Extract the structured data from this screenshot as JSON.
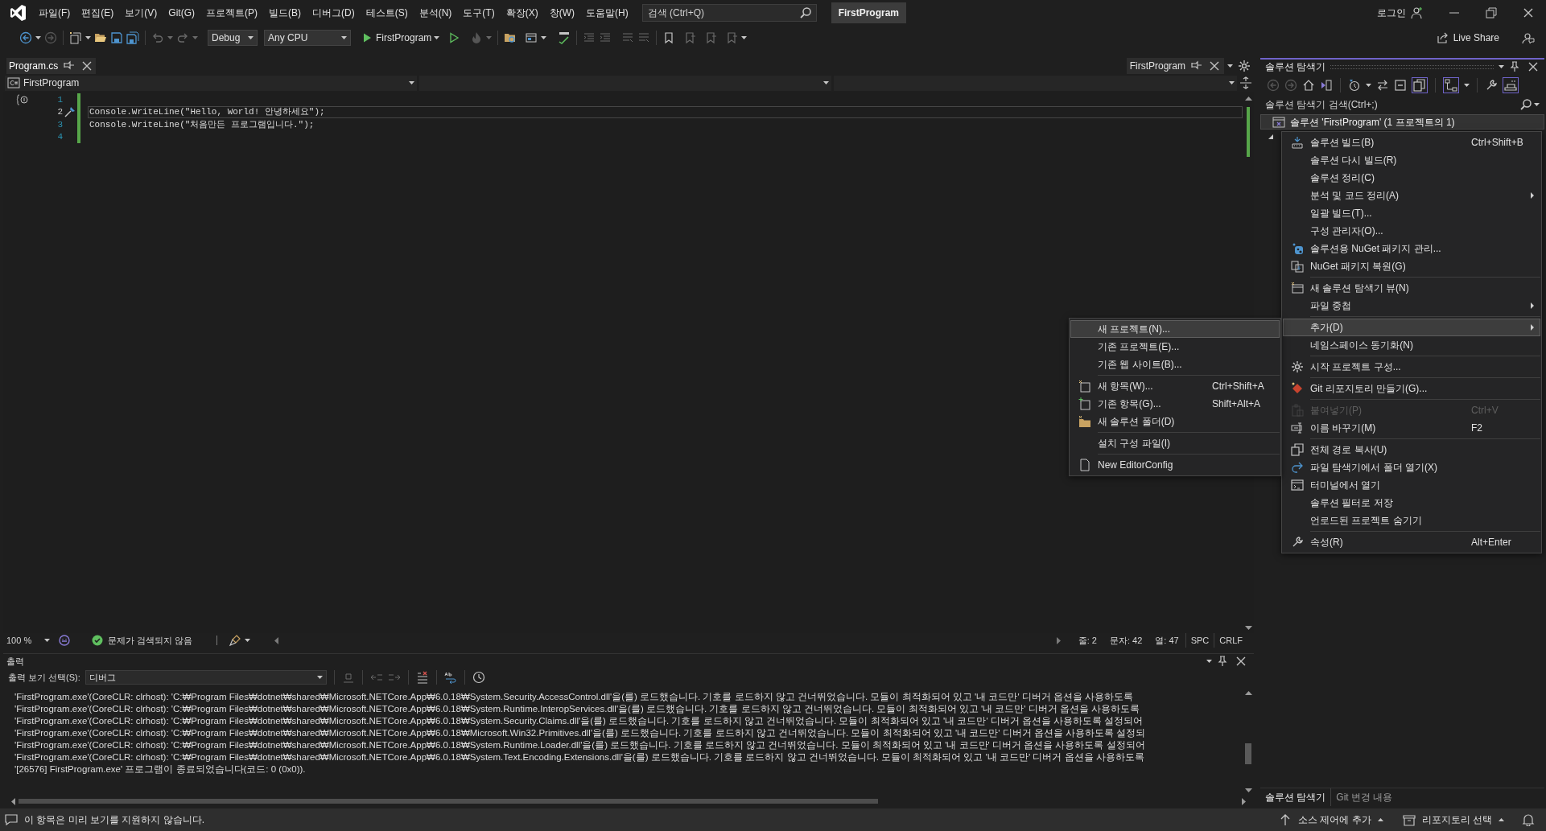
{
  "menu_bar": {
    "items": [
      "파일(F)",
      "편집(E)",
      "보기(V)",
      "Git(G)",
      "프로젝트(P)",
      "빌드(B)",
      "디버그(D)",
      "테스트(S)",
      "분석(N)",
      "도구(T)",
      "확장(X)",
      "창(W)",
      "도움말(H)"
    ],
    "search": {
      "placeholder": "검색 (Ctrl+Q)"
    },
    "solution_name": "FirstProgram",
    "sign_in": "로그인"
  },
  "toolbar": {
    "configuration": "Debug",
    "platform": "Any CPU",
    "start_target": "FirstProgram",
    "live_share": "Live Share"
  },
  "document_tabs": [
    {
      "label": "Program.cs",
      "selected": true
    }
  ],
  "preview_tab": "FirstProgram",
  "nav_bar": {
    "project": "FirstProgram"
  },
  "editor": {
    "lines": [
      {
        "number": "1",
        "changed": true,
        "current": false,
        "kind": "scope"
      },
      {
        "number": "2",
        "text": "Console.WriteLine(\"Hello, World! 안녕하세요\");",
        "changed": true,
        "current": true,
        "kind": "quick-action"
      },
      {
        "number": "3",
        "text": "Console.WriteLine(\"처음만든 프로그램입니다.\");",
        "changed": true,
        "current": false,
        "kind": "plain"
      },
      {
        "number": "4",
        "changed": true,
        "current": false,
        "kind": "plain"
      }
    ]
  },
  "editor_status": {
    "zoom": "100 %",
    "issues": "문제가 검색되지 않음",
    "line": "줄: 2",
    "char": "문자: 42",
    "col": "열: 47",
    "whitespace": "SPC",
    "line_ending": "CRLF"
  },
  "output": {
    "title": "출력",
    "source_label": "출력 보기 선택(S):",
    "source": "디버그",
    "lines": [
      "'FirstProgram.exe'(CoreCLR: clrhost): 'C:₩Program Files₩dotnet₩shared₩Microsoft.NETCore.App₩6.0.18₩System.Security.AccessControl.dll'을(를) 로드했습니다. 기호를 로드하지 않고 건너뛰었습니다. 모듈이 최적화되어 있고 '내 코드만' 디버거 옵션을 사용하도록",
      "'FirstProgram.exe'(CoreCLR: clrhost): 'C:₩Program Files₩dotnet₩shared₩Microsoft.NETCore.App₩6.0.18₩System.Runtime.InteropServices.dll'을(를) 로드했습니다. 기호를 로드하지 않고 건너뛰었습니다. 모듈이 최적화되어 있고 '내 코드만' 디버거 옵션을 사용하도록",
      "'FirstProgram.exe'(CoreCLR: clrhost): 'C:₩Program Files₩dotnet₩shared₩Microsoft.NETCore.App₩6.0.18₩System.Security.Claims.dll'을(를) 로드했습니다. 기호를 로드하지 않고 건너뛰었습니다. 모듈이 최적화되어 있고 '내 코드만' 디버거 옵션을 사용하도록 설정되어",
      "'FirstProgram.exe'(CoreCLR: clrhost): 'C:₩Program Files₩dotnet₩shared₩Microsoft.NETCore.App₩6.0.18₩Microsoft.Win32.Primitives.dll'을(를) 로드했습니다. 기호를 로드하지 않고 건너뛰었습니다. 모듈이 최적화되어 있고 '내 코드만' 디버거 옵션을 사용하도록 설정되",
      "'FirstProgram.exe'(CoreCLR: clrhost): 'C:₩Program Files₩dotnet₩shared₩Microsoft.NETCore.App₩6.0.18₩System.Runtime.Loader.dll'을(를) 로드했습니다. 기호를 로드하지 않고 건너뛰었습니다. 모듈이 최적화되어 있고 '내 코드만' 디버거 옵션을 사용하도록 설정되어",
      "'FirstProgram.exe'(CoreCLR: clrhost): 'C:₩Program Files₩dotnet₩shared₩Microsoft.NETCore.App₩6.0.18₩System.Text.Encoding.Extensions.dll'을(를) 로드했습니다. 기호를 로드하지 않고 건너뛰었습니다. 모듈이 최적화되어 있고 '내 코드만' 디버거 옵션을 사용하도록",
      "'[26576] FirstProgram.exe' 프로그램이 종료되었습니다(코드: 0 (0x0))."
    ]
  },
  "solution_explorer": {
    "title": "솔루션 탐색기",
    "search": {
      "placeholder": "솔루션 탐색기 검색(Ctrl+;)"
    },
    "root": {
      "label": "솔루션 'FirstProgram' (1 프로젝트의 1)",
      "selected": true
    },
    "tabs": [
      {
        "label": "솔루션 탐색기",
        "selected": true
      },
      {
        "label": "Git 변경 내용",
        "selected": false
      }
    ]
  },
  "context_menu": {
    "groups": [
      [
        {
          "label": "솔루션 빌드(B)",
          "shortcut": "Ctrl+Shift+B",
          "submenu": false,
          "disabled": false,
          "selected": false
        },
        {
          "label": "솔루션 다시 빌드(R)",
          "submenu": false,
          "disabled": false,
          "selected": false
        },
        {
          "label": "솔루션 정리(C)",
          "submenu": false,
          "disabled": false,
          "selected": false
        },
        {
          "label": "분석 및 코드 정리(A)",
          "submenu": true,
          "disabled": false,
          "selected": false
        },
        {
          "label": "일괄 빌드(T)...",
          "submenu": false,
          "disabled": false,
          "selected": false
        },
        {
          "label": "구성 관리자(O)...",
          "submenu": false,
          "disabled": false,
          "selected": false
        },
        {
          "label": "솔루션용 NuGet 패키지 관리...",
          "submenu": false,
          "disabled": false,
          "selected": false
        },
        {
          "label": "NuGet 패키지 복원(G)",
          "submenu": false,
          "disabled": false,
          "selected": false
        }
      ],
      [
        {
          "label": "새 솔루션 탐색기 뷰(N)",
          "submenu": false,
          "disabled": false,
          "selected": false
        },
        {
          "label": "파일 중첩",
          "submenu": true,
          "disabled": false,
          "selected": false
        }
      ],
      [
        {
          "label": "추가(D)",
          "submenu": true,
          "disabled": false,
          "selected": true
        },
        {
          "label": "네임스페이스 동기화(N)",
          "submenu": false,
          "disabled": false,
          "selected": false
        }
      ],
      [
        {
          "label": "시작 프로젝트 구성...",
          "submenu": false,
          "disabled": false,
          "selected": false
        }
      ],
      [
        {
          "label": "Git 리포지토리 만들기(G)...",
          "submenu": false,
          "disabled": false,
          "selected": false
        }
      ],
      [
        {
          "label": "붙여넣기(P)",
          "shortcut": "Ctrl+V",
          "submenu": false,
          "disabled": true,
          "selected": false
        },
        {
          "label": "이름 바꾸기(M)",
          "shortcut": "F2",
          "submenu": false,
          "disabled": false,
          "selected": false
        }
      ],
      [
        {
          "label": "전체 경로 복사(U)",
          "submenu": false,
          "disabled": false,
          "selected": false
        },
        {
          "label": "파일 탐색기에서 폴더 열기(X)",
          "submenu": false,
          "disabled": false,
          "selected": false
        },
        {
          "label": "터미널에서 열기",
          "submenu": false,
          "disabled": false,
          "selected": false
        },
        {
          "label": "솔루션 필터로 저장",
          "submenu": false,
          "disabled": false,
          "selected": false
        },
        {
          "label": "언로드된 프로젝트 숨기기",
          "submenu": false,
          "disabled": false,
          "selected": false
        }
      ],
      [
        {
          "label": "속성(R)",
          "shortcut": "Alt+Enter",
          "submenu": false,
          "disabled": false,
          "selected": false
        }
      ]
    ]
  },
  "add_submenu": {
    "groups": [
      [
        {
          "label": "새 프로젝트(N)...",
          "submenu": false,
          "disabled": false,
          "selected": true
        },
        {
          "label": "기존 프로젝트(E)...",
          "submenu": false,
          "disabled": false,
          "selected": false
        },
        {
          "label": "기존 웹 사이트(B)...",
          "submenu": false,
          "disabled": false,
          "selected": false
        }
      ],
      [
        {
          "label": "새 항목(W)...",
          "shortcut": "Ctrl+Shift+A",
          "submenu": false,
          "disabled": false,
          "selected": false
        },
        {
          "label": "기존 항목(G)...",
          "shortcut": "Shift+Alt+A",
          "submenu": false,
          "disabled": false,
          "selected": false
        },
        {
          "label": "새 솔루션 폴더(D)",
          "submenu": false,
          "disabled": false,
          "selected": false
        }
      ],
      [
        {
          "label": "설치 구성 파일(I)",
          "submenu": false,
          "disabled": false,
          "selected": false
        }
      ],
      [
        {
          "label": "New EditorConfig",
          "submenu": false,
          "disabled": false,
          "selected": false
        }
      ]
    ]
  },
  "status_bar": {
    "message": "이 항목은 미리 보기를 지원하지 않습니다.",
    "source_control": "소스 제어에 추가",
    "repository": "리포지토리 선택"
  }
}
